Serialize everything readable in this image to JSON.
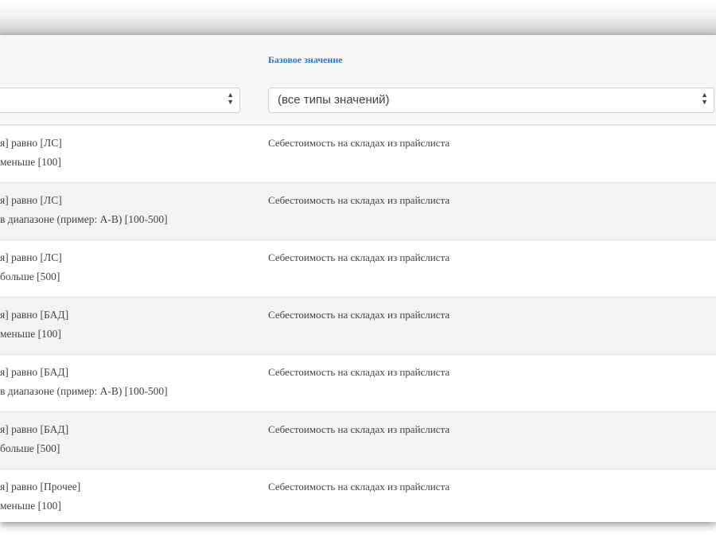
{
  "table": {
    "base_value_header": "Базовое значение",
    "filters": {
      "left_value": "",
      "right_value": "(все типы значений)"
    },
    "rows": [
      {
        "condition_1": "я] равно [ЛС]",
        "condition_2": "меньше [100]",
        "base_value": "Себестоимость на складах из прайслиста"
      },
      {
        "condition_1": "я] равно [ЛС]",
        "condition_2": "в диапазоне (пример: А-В) [100-500]",
        "base_value": "Себестоимость на складах из прайслиста"
      },
      {
        "condition_1": "я] равно [ЛС]",
        "condition_2": "больше [500]",
        "base_value": "Себестоимость на складах из прайслиста"
      },
      {
        "condition_1": "я] равно [БАД]",
        "condition_2": "меньше [100]",
        "base_value": "Себестоимость на складах из прайслиста"
      },
      {
        "condition_1": "я] равно [БАД]",
        "condition_2": "в диапазоне (пример: А-В) [100-500]",
        "base_value": "Себестоимость на складах из прайслиста"
      },
      {
        "condition_1": "я] равно [БАД]",
        "condition_2": "больше [500]",
        "base_value": "Себестоимость на складах из прайслиста"
      },
      {
        "condition_1": "я] равно [Прочее]",
        "condition_2": "меньше [100]",
        "base_value": "Себестоимость на складах из прайслиста"
      }
    ]
  },
  "icons": {
    "select_arrows": "updown-chevron-icon"
  },
  "colors": {
    "header_link": "#2a7ac0",
    "row_alt": "#f3f3f3",
    "header_bg": "#f7f7f7"
  }
}
